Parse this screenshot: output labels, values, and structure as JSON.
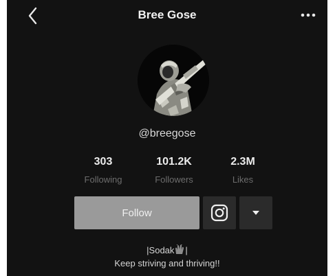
{
  "header": {
    "title": "Bree Gose",
    "back_icon": "chevron-left-icon",
    "more_icon": "ellipsis-icon"
  },
  "profile": {
    "username": "@breegose",
    "avatar": "profile-photo"
  },
  "stats": {
    "following": {
      "value": "303",
      "label": "Following"
    },
    "followers": {
      "value": "101.2K",
      "label": "Followers"
    },
    "likes": {
      "value": "2.3M",
      "label": "Likes"
    }
  },
  "actions": {
    "follow_label": "Follow",
    "instagram_icon": "instagram-icon",
    "dropdown_icon": "caret-down-icon"
  },
  "bio": {
    "line1_before": "|Sodak",
    "line1_emoji": "clap-hands-icon",
    "line1_after": "|",
    "line2": "Keep striving and thriving!!"
  },
  "colors": {
    "background": "#121212",
    "follow_button": "#9a9a9a",
    "icon_button": "#2b2b2b",
    "muted_label": "#6d6d6d"
  }
}
